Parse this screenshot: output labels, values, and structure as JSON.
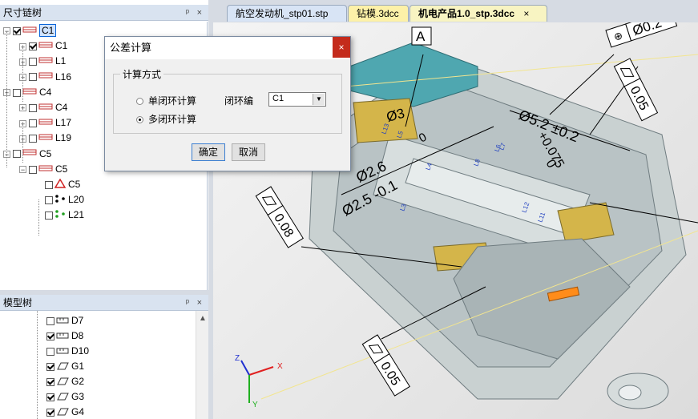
{
  "chain_panel": {
    "title": "尺寸链树",
    "pin": "ᵖ",
    "close": "×",
    "nodes": [
      {
        "label": "C1",
        "level": 0,
        "expander": "−",
        "checked": true,
        "selected": true,
        "icon": "chain-icon"
      },
      {
        "label": "C1",
        "level": 1,
        "expander": "+",
        "checked": true,
        "selected": false,
        "icon": "chain-icon"
      },
      {
        "label": "L1",
        "level": 1,
        "expander": "+",
        "checked": false,
        "selected": false,
        "icon": "chain-icon"
      },
      {
        "label": "L16",
        "level": 1,
        "expander": "+",
        "checked": false,
        "selected": false,
        "icon": "chain-icon"
      },
      {
        "label": "C4",
        "level": 0,
        "expander": "+",
        "checked": false,
        "selected": false,
        "icon": "chain-icon"
      },
      {
        "label": "C4",
        "level": 1,
        "expander": "+",
        "checked": false,
        "selected": false,
        "icon": "chain-icon"
      },
      {
        "label": "L17",
        "level": 1,
        "expander": "+",
        "checked": false,
        "selected": false,
        "icon": "chain-icon"
      },
      {
        "label": "L19",
        "level": 1,
        "expander": "+",
        "checked": false,
        "selected": false,
        "icon": "chain-icon"
      },
      {
        "label": "C5",
        "level": 0,
        "expander": "−",
        "checked": false,
        "selected": false,
        "icon": "chain-icon"
      },
      {
        "label": "C5",
        "level": 1,
        "expander": "−",
        "checked": false,
        "selected": false,
        "icon": "chain-icon"
      },
      {
        "label": "C5",
        "level": 2,
        "expander": "",
        "checked": false,
        "selected": false,
        "icon": "triangle-icon"
      },
      {
        "label": "L20",
        "level": 2,
        "expander": "",
        "checked": false,
        "selected": false,
        "icon": "dots-icon"
      },
      {
        "label": "L21",
        "level": 2,
        "expander": "",
        "checked": false,
        "selected": false,
        "icon": "green-dots-icon"
      }
    ]
  },
  "model_panel": {
    "title": "模型树",
    "pin": "ᵖ",
    "close": "×",
    "nodes": [
      {
        "label": "D7",
        "checked": false,
        "icon": "dimension-icon"
      },
      {
        "label": "D8",
        "checked": true,
        "icon": "dimension-icon"
      },
      {
        "label": "D10",
        "checked": false,
        "icon": "dimension-icon"
      },
      {
        "label": "G1",
        "checked": true,
        "icon": "flatness-icon"
      },
      {
        "label": "G2",
        "checked": true,
        "icon": "flatness-icon"
      },
      {
        "label": "G3",
        "checked": true,
        "icon": "flatness-icon"
      },
      {
        "label": "G4",
        "checked": true,
        "icon": "flatness-icon"
      }
    ]
  },
  "tabs": [
    {
      "label": "航空发动机_stp01.stp",
      "active": false
    },
    {
      "label": "钻模.3dcc",
      "active": false
    },
    {
      "label": "机电产品1.0_stp.3dcc",
      "active": true,
      "close": "×"
    }
  ],
  "dialog": {
    "title": "公差计算",
    "close": "×",
    "group_label": "计算方式",
    "option_single": "单闭环计算",
    "option_multi": "多闭环计算",
    "selected_option": "multi",
    "loop_label": "闭环编",
    "loop_value": "C1",
    "ok": "确定",
    "cancel": "取消"
  },
  "viewport": {
    "datum_label": "A",
    "dim_top_right": "Ø0.2",
    "tol_flat_1": "0.05",
    "dim_52": "Ø5.2 ±0.2",
    "dim_52_tol": "+0.075",
    "dim_52_zero": "0",
    "dim_3": "Ø3",
    "dim_26": "Ø2.6",
    "dim_25": "Ø2.5 -0.1",
    "dim_26_tol": "0",
    "tol_flat_left": "0.08",
    "tol_flat_bottom": "0.05",
    "axis_x": "X",
    "axis_y": "Y",
    "axis_z": "Z",
    "small_labels": [
      "L3",
      "L4",
      "L5",
      "L6",
      "L7",
      "L8",
      "L11",
      "L12",
      "L13"
    ],
    "colors": {
      "housing": "#c9d1d1",
      "housing_dark": "#97a3a6",
      "teal": "#4fa7b0",
      "yellow": "#d4b54a",
      "orange": "#ff8c1a",
      "dialog_close": "#c42b1c",
      "selection": "#0a64d8"
    }
  }
}
